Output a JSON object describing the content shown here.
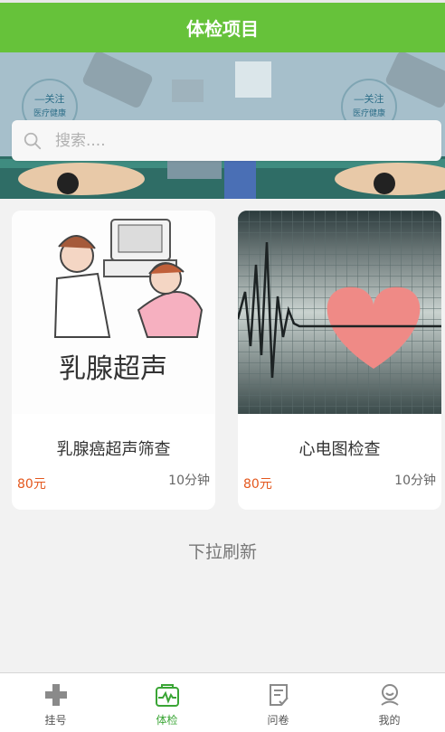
{
  "header": {
    "title": "体检项目"
  },
  "banner": {
    "badge_line1": "—关注",
    "badge_line2": "医疗健康"
  },
  "search": {
    "placeholder": "搜索...."
  },
  "items": [
    {
      "name": "乳腺癌超声筛查",
      "image_caption": "乳腺超声",
      "price": "80元",
      "duration": "10分钟"
    },
    {
      "name": "心电图检查",
      "price": "80元",
      "duration": "10分钟"
    }
  ],
  "refresh_text": "下拉刷新",
  "tabs": [
    {
      "label": "挂号",
      "icon": "medical-cross-icon"
    },
    {
      "label": "体检",
      "icon": "health-check-icon",
      "active": true
    },
    {
      "label": "问卷",
      "icon": "survey-icon"
    },
    {
      "label": "我的",
      "icon": "profile-icon"
    }
  ],
  "colors": {
    "primary": "#66c23a",
    "active_tab": "#3aa535",
    "price": "#e4571d"
  }
}
